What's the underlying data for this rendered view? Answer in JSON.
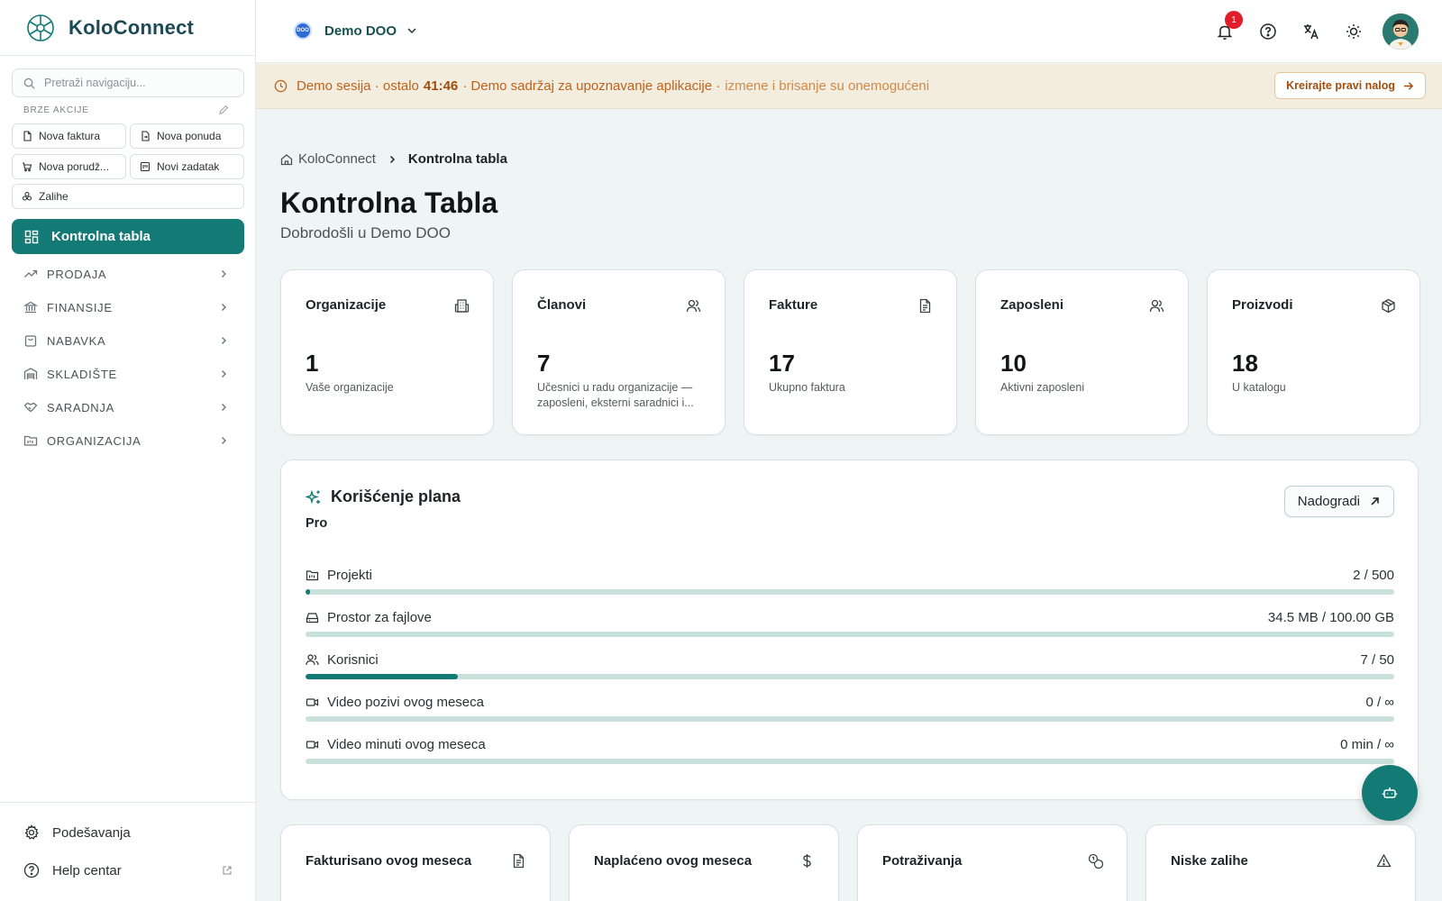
{
  "app": {
    "name": "KoloConnect"
  },
  "sidebar": {
    "search_placeholder": "Pretraži navigaciju...",
    "quick_actions_title": "BRZE AKCIJE",
    "quick_actions": [
      {
        "label": "Nova faktura",
        "icon": "file-icon"
      },
      {
        "label": "Nova ponuda",
        "icon": "file-arrow-icon"
      },
      {
        "label": "Nova porudž...",
        "icon": "cart-icon"
      },
      {
        "label": "Novi zadatak",
        "icon": "task-icon"
      },
      {
        "label": "Zalihe",
        "icon": "boxes-icon"
      }
    ],
    "active_item": "Kontrolna tabla",
    "sections": [
      {
        "label": "PRODAJA",
        "icon": "trend-icon"
      },
      {
        "label": "FINANSIJE",
        "icon": "bank-icon"
      },
      {
        "label": "NABAVKA",
        "icon": "bag-icon"
      },
      {
        "label": "SKLADIŠTE",
        "icon": "warehouse-icon"
      },
      {
        "label": "SARADNJA",
        "icon": "handshake-icon"
      },
      {
        "label": "ORGANIZACIJA",
        "icon": "folder-icon"
      }
    ],
    "settings_label": "Podešavanja",
    "help_label": "Help centar"
  },
  "topbar": {
    "org_name": "Demo DOO",
    "org_badge": "DOO",
    "notification_count": "1"
  },
  "banner": {
    "prefix": "Demo sesija · ostalo",
    "time_left": "41:46",
    "middle": "· Demo sadržaj za upoznavanje aplikacije ·",
    "muted": "izmene i brisanje su onemogućeni",
    "cta": "Kreirajte pravi nalog"
  },
  "breadcrumb": {
    "root": "KoloConnect",
    "current": "Kontrolna tabla"
  },
  "page": {
    "title": "Kontrolna Tabla",
    "subtitle": "Dobrodošli u Demo DOO"
  },
  "stats": [
    {
      "label": "Organizacije",
      "value": "1",
      "desc": "Vaše organizacije",
      "icon": "building-icon"
    },
    {
      "label": "Članovi",
      "value": "7",
      "desc": "Učesnici u radu organizacije — zaposleni, eksterni saradnici i...",
      "icon": "users-icon"
    },
    {
      "label": "Fakture",
      "value": "17",
      "desc": "Ukupno faktura",
      "icon": "document-icon"
    },
    {
      "label": "Zaposleni",
      "value": "10",
      "desc": "Aktivni zaposleni",
      "icon": "users-icon"
    },
    {
      "label": "Proizvodi",
      "value": "18",
      "desc": "U katalogu",
      "icon": "package-icon"
    }
  ],
  "plan": {
    "title": "Korišćenje plana",
    "tier": "Pro",
    "upgrade_label": "Nadogradi",
    "rows": [
      {
        "label": "Projekti",
        "value": "2 / 500",
        "fraction": 0.004,
        "icon": "folder-icon"
      },
      {
        "label": "Prostor za fajlove",
        "value": "34.5 MB / 100.00 GB",
        "fraction": 0.0003,
        "icon": "drive-icon"
      },
      {
        "label": "Korisnici",
        "value": "7 / 50",
        "fraction": 0.14,
        "icon": "users-icon"
      },
      {
        "label": "Video pozivi ovog meseca",
        "value": "0 / ∞",
        "fraction": 0,
        "icon": "video-icon"
      },
      {
        "label": "Video minuti ovog meseca",
        "value": "0 min / ∞",
        "fraction": 0,
        "icon": "video-icon"
      }
    ]
  },
  "bottom_cards": [
    {
      "label": "Fakturisano ovog meseca",
      "icon": "document-icon"
    },
    {
      "label": "Naplaćeno ovog meseca",
      "icon": "dollar-icon"
    },
    {
      "label": "Potraživanja",
      "icon": "coins-icon"
    },
    {
      "label": "Niske zalihe",
      "icon": "warning-icon"
    }
  ],
  "colors": {
    "accent": "#137a76",
    "banner_text": "#c0621a",
    "badge": "#e11d2c"
  }
}
